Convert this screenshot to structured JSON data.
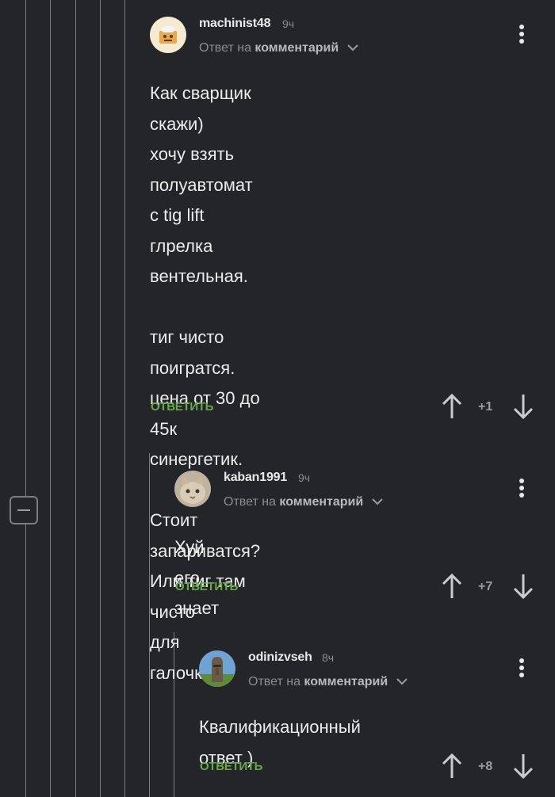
{
  "comments": [
    {
      "username": "machinist48",
      "time": "9ч",
      "reply_prefix": "Ответ на",
      "reply_target": "комментарий",
      "text": "Как сварщик скажи)\nхочу взять полуавтомат с tig lift\nглрелка вентельная.\n\nтиг чисто поигратся.\nцена от 30 до 45к\nсинергетик.\n\nСтоит запариватся? Или тиг там чисто\nдля галочки...",
      "reply_label": "ОТВЕТИТЬ",
      "score": "+1"
    },
    {
      "username": "kaban1991",
      "time": "9ч",
      "reply_prefix": "Ответ на",
      "reply_target": "комментарий",
      "text": "Хуй его знает",
      "reply_label": "ОТВЕТИТЬ",
      "score": "+7"
    },
    {
      "username": "odinizvseh",
      "time": "8ч",
      "reply_prefix": "Ответ на",
      "reply_target": "комментарий",
      "text": "Квалификационный ответ )",
      "reply_label": "ОТВЕТИТЬ",
      "score": "+8"
    }
  ],
  "icons": {
    "menu": "more-vertical-icon",
    "upvote": "arrow-up-icon",
    "downvote": "arrow-down-icon",
    "collapse": "minus-square-icon",
    "chevron": "chevron-down-icon"
  },
  "colors": {
    "background": "#232529",
    "reply_button": "#6aa84f",
    "thread_line": "#7b7d82"
  }
}
